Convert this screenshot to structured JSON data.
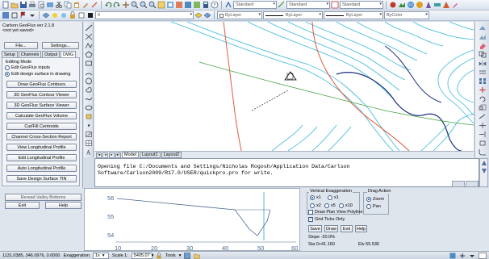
{
  "toolbar": {
    "style_dd": "Standard",
    "dim_dd": "Standard",
    "table_dd": "Standard",
    "layer_dd": "0",
    "color_dd": "ByLayer",
    "linetype_dd": "ByLayer",
    "lineweight_dd": "ByLayer",
    "plot_dd": "ByColor",
    "accent": "#1c4fa0"
  },
  "panel": {
    "title": "Carlson GeoFlux ver 2.1.8",
    "status": "<not yet saved>",
    "file_btn": "File...",
    "settings_btn": "Settings...",
    "tabs": [
      "Setup",
      "Channels",
      "Output",
      "DWG"
    ],
    "active_tab": "DWG",
    "edit_mode_label": "Editing Mode",
    "radio_edit_inputs": "Edit GeoFlux inputs",
    "radio_edit_surface": "Edit design surface in drawing",
    "buttons": [
      "Draw GeoFlux Contours",
      "3D GeoFlux Contour Viewer",
      "3D GeoFlux Surface Viewer",
      "Calculate GeoFlux Volume",
      "Cut/Fill Centroids",
      "Channel Cross-Section Report",
      "View Longitudinal Profile",
      "Edit Longitudinal Profile",
      "Auto Longitudinal Profile",
      "Save Design Surface TIN"
    ]
  },
  "canvas": {
    "layout_tabs": [
      "Model",
      "Layout1",
      "Layout2"
    ],
    "active_layout": "Model"
  },
  "command": {
    "line1": "Opening file C:/Documents and Settings/Nicholas Rogosh/Application Data/Carlson",
    "line2": "Software/Carlson2009/R17.0/USER/quickpro.pro for write."
  },
  "profile": {
    "reread_btn": "Reread Valley Bottoms",
    "exit_btn": "Exit",
    "help_btn": "Help",
    "y_labels": [
      "56",
      "55",
      "54"
    ],
    "x_labels": [
      "10",
      "20",
      "30",
      "40",
      "50",
      "60"
    ],
    "vertical_exag_label": "Vertical Exaggeration",
    "exag_options": [
      "x1",
      "x1",
      "x2",
      "x5",
      "x10"
    ],
    "drag_action_label": "Drag Action",
    "drag_options": [
      "Zoom",
      "Pan"
    ],
    "draw_plan_view": "Draw Plan View Polyline",
    "grid_ticks_only": "Grid Ticks Only",
    "save_btn": "Save",
    "draw_btn": "Draw",
    "exit_btn2": "Exit",
    "help_btn2": "Help",
    "slope": "Slope -20.0%",
    "sta": "Sta 0+41.160",
    "elv": "Elv 55.536"
  },
  "status": {
    "coords": "1131.0385, 346.0976, 0.0000",
    "exaggeration_label": "Exaggeration",
    "exaggeration_val": "1x",
    "scale_label": "Scale 1:",
    "scale_val": "5405.07",
    "tools_label": "Tools"
  }
}
